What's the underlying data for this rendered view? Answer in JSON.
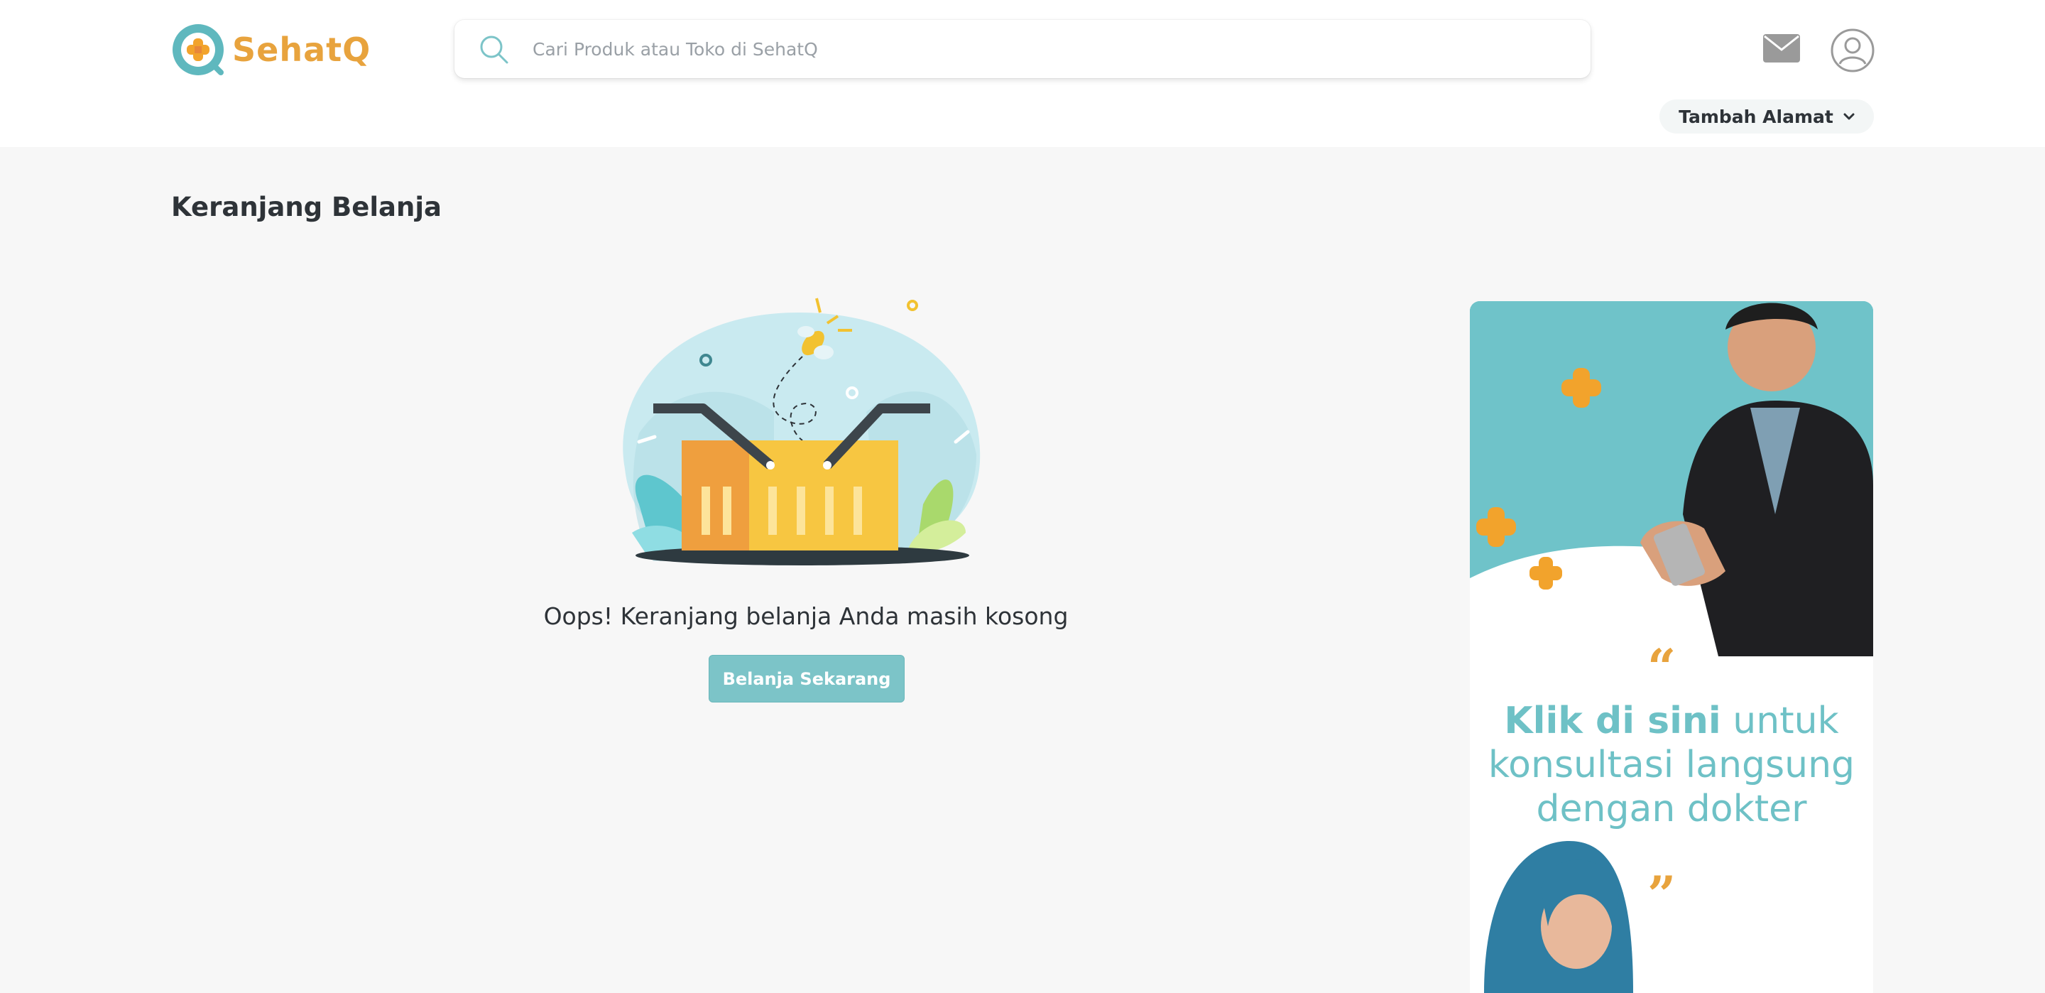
{
  "header": {
    "brand": "SehatQ",
    "search_placeholder": "Cari Produk atau Toko di SehatQ",
    "address_label": "Tambah Alamat"
  },
  "main": {
    "page_title": "Keranjang Belanja",
    "empty_message": "Oops! Keranjang belanja Anda masih kosong",
    "cta_label": "Belanja Sekarang"
  },
  "banner": {
    "headline_bold": "Klik di sini",
    "headline_rest_1": " untuk",
    "headline_line_2": "konsultasi langsung",
    "headline_line_3": "dengan dokter",
    "quote_open": "“",
    "quote_close": "”"
  },
  "colors": {
    "brand_orange": "#e8a33d",
    "brand_teal": "#6fc3c9",
    "button_teal": "#7cc4c8",
    "page_bg": "#f7f7f7"
  },
  "icons": [
    "sehatq-logo-icon",
    "search-icon",
    "mail-icon",
    "user-account-icon",
    "chevron-down-icon",
    "empty-basket-illustration"
  ]
}
